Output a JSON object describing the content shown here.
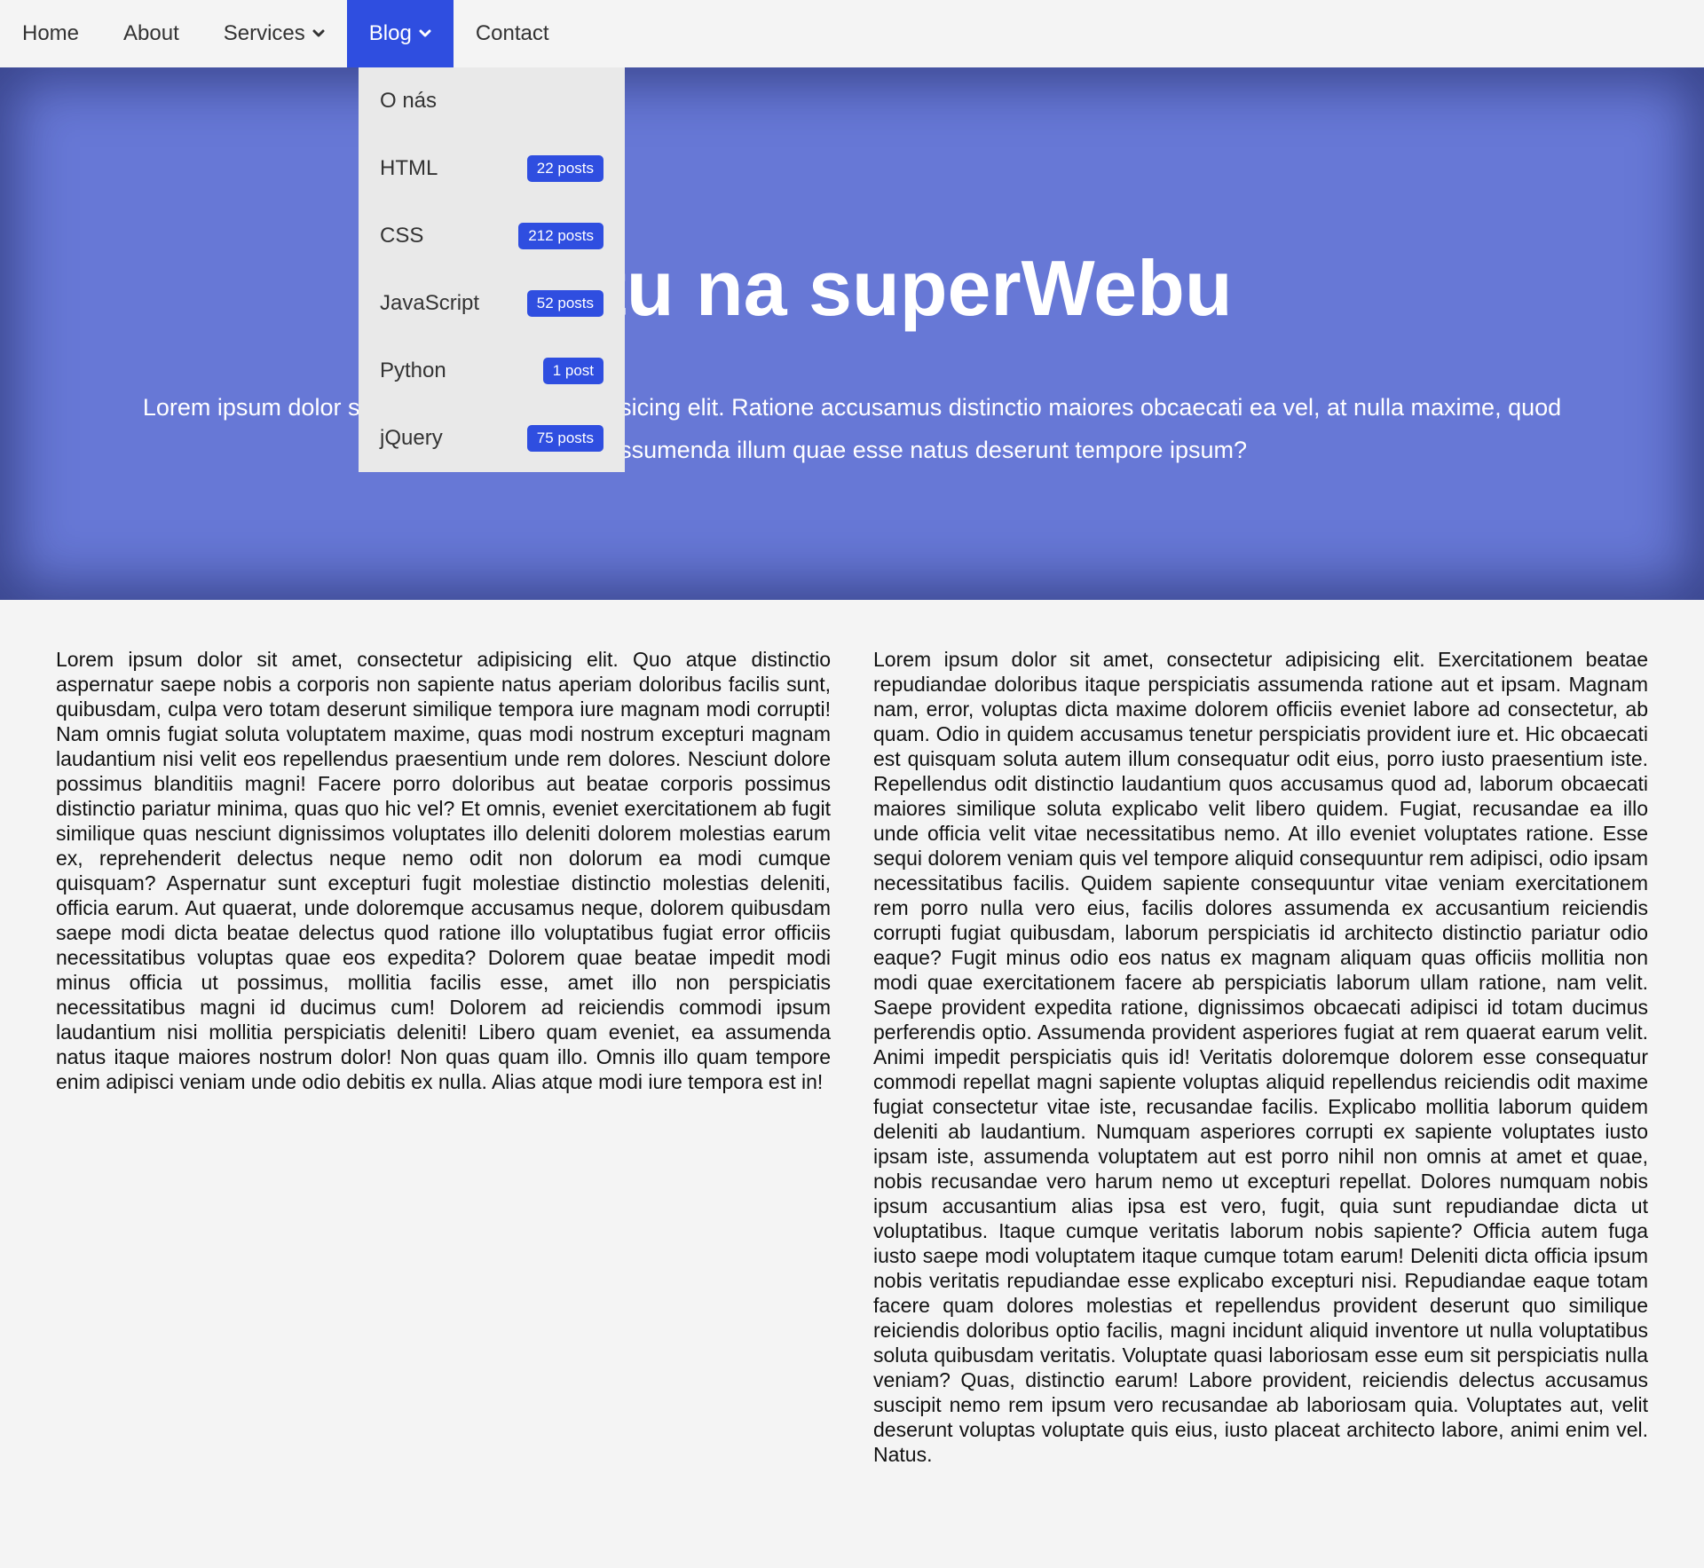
{
  "nav": {
    "items": [
      {
        "label": "Home"
      },
      {
        "label": "About"
      },
      {
        "label": "Services"
      },
      {
        "label": "Blog"
      },
      {
        "label": "Contact"
      }
    ]
  },
  "dropdown": {
    "items": [
      {
        "label": "O nás",
        "badge": ""
      },
      {
        "label": "HTML",
        "badge": "22 posts"
      },
      {
        "label": "CSS",
        "badge": "212 posts"
      },
      {
        "label": "JavaScript",
        "badge": "52 posts"
      },
      {
        "label": "Python",
        "badge": "1 post"
      },
      {
        "label": "jQuery",
        "badge": "75 posts"
      }
    ]
  },
  "hero": {
    "title": "tu na superWebu",
    "text": "Lorem ipsum dolor sit amet consectetur adipisicing elit. Ratione accusamus distinctio maiores obcaecati ea vel, at nulla maxime, quod reprehenderit assumenda illum quae esse natus deserunt tempore ipsum?"
  },
  "content": {
    "col1": "Lorem ipsum dolor sit amet, consectetur adipisicing elit. Quo atque distinctio aspernatur saepe nobis a corporis non sapiente natus aperiam doloribus facilis sunt, quibusdam, culpa vero totam deserunt similique tempora iure magnam modi corrupti! Nam omnis fugiat soluta voluptatem maxime, quas modi nostrum excepturi magnam laudantium nisi velit eos repellendus praesentium unde rem dolores. Nesciunt dolore possimus blanditiis magni! Facere porro doloribus aut beatae corporis possimus distinctio pariatur minima, quas quo hic vel? Et omnis, eveniet exercitationem ab fugit similique quas nesciunt dignissimos voluptates illo deleniti dolorem molestias earum ex, reprehenderit delectus neque nemo odit non dolorum ea modi cumque quisquam? Aspernatur sunt excepturi fugit molestiae distinctio molestias deleniti, officia earum. Aut quaerat, unde doloremque accusamus neque, dolorem quibusdam saepe modi dicta beatae delectus quod ratione illo voluptatibus fugiat error officiis necessitatibus voluptas quae eos expedita? Dolorem quae beatae impedit modi minus officia ut possimus, mollitia facilis esse, amet illo non perspiciatis necessitatibus magni id ducimus cum! Dolorem ad reiciendis commodi ipsum laudantium nisi mollitia perspiciatis deleniti! Libero quam eveniet, ea assumenda natus itaque maiores nostrum dolor! Non quas quam illo. Omnis illo quam tempore enim adipisci veniam unde odio debitis ex nulla. Alias atque modi iure tempora est in!",
    "col2": "Lorem ipsum dolor sit amet, consectetur adipisicing elit. Exercitationem beatae repudiandae doloribus itaque perspiciatis assumenda ratione aut et ipsam. Magnam nam, error, voluptas dicta maxime dolorem officiis eveniet labore ad consectetur, ab quam. Odio in quidem accusamus tenetur perspiciatis provident iure et. Hic obcaecati est quisquam soluta autem illum consequatur odit eius, porro iusto praesentium iste. Repellendus odit distinctio laudantium quos accusamus quod ad, laborum obcaecati maiores similique soluta explicabo velit libero quidem. Fugiat, recusandae ea illo unde officia velit vitae necessitatibus nemo. At illo eveniet voluptates ratione. Esse sequi dolorem veniam quis vel tempore aliquid consequuntur rem adipisci, odio ipsam necessitatibus facilis. Quidem sapiente consequuntur vitae veniam exercitationem rem porro nulla vero eius, facilis dolores assumenda ex accusantium reiciendis corrupti fugiat quibusdam, laborum perspiciatis id architecto distinctio pariatur odio eaque? Fugit minus odio eos natus ex magnam aliquam quas officiis mollitia non modi quae exercitationem facere ab perspiciatis laborum ullam ratione, nam velit. Saepe provident expedita ratione, dignissimos obcaecati adipisci id totam ducimus perferendis optio. Assumenda provident asperiores fugiat at rem quaerat earum velit. Animi impedit perspiciatis quis id! Veritatis doloremque dolorem esse consequatur commodi repellat magni sapiente voluptas aliquid repellendus reiciendis odit maxime fugiat consectetur vitae iste, recusandae facilis. Explicabo mollitia laborum quidem deleniti ab laudantium. Numquam asperiores corrupti ex sapiente voluptates iusto ipsam iste, assumenda voluptatem aut est porro nihil non omnis at amet et quae, nobis recusandae vero harum nemo ut excepturi repellat. Dolores numquam nobis ipsum accusantium alias ipsa est vero, fugit, quia sunt repudiandae dicta ut voluptatibus. Itaque cumque veritatis laborum nobis sapiente? Officia autem fuga iusto saepe modi voluptatem itaque cumque totam earum! Deleniti dicta officia ipsum nobis veritatis repudiandae esse explicabo excepturi nisi. Repudiandae eaque totam facere quam dolores molestias et repellendus provident deserunt quo similique reiciendis doloribus optio facilis, magni incidunt aliquid inventore ut nulla voluptatibus soluta quibusdam veritatis. Voluptate quasi laboriosam esse eum sit perspiciatis nulla veniam? Quas, distinctio earum! Labore provident, reiciendis delectus accusamus suscipit nemo rem ipsum vero recusandae ab laboriosam quia. Voluptates aut, velit deserunt voluptas voluptate quis eius, iusto placeat architecto labore, animi enim vel. Natus."
  },
  "colors": {
    "accent": "#2f4ee0",
    "hero_bg": "#6778d6",
    "dropdown_bg": "#e9e9e9",
    "page_bg": "#f4f4f4"
  }
}
